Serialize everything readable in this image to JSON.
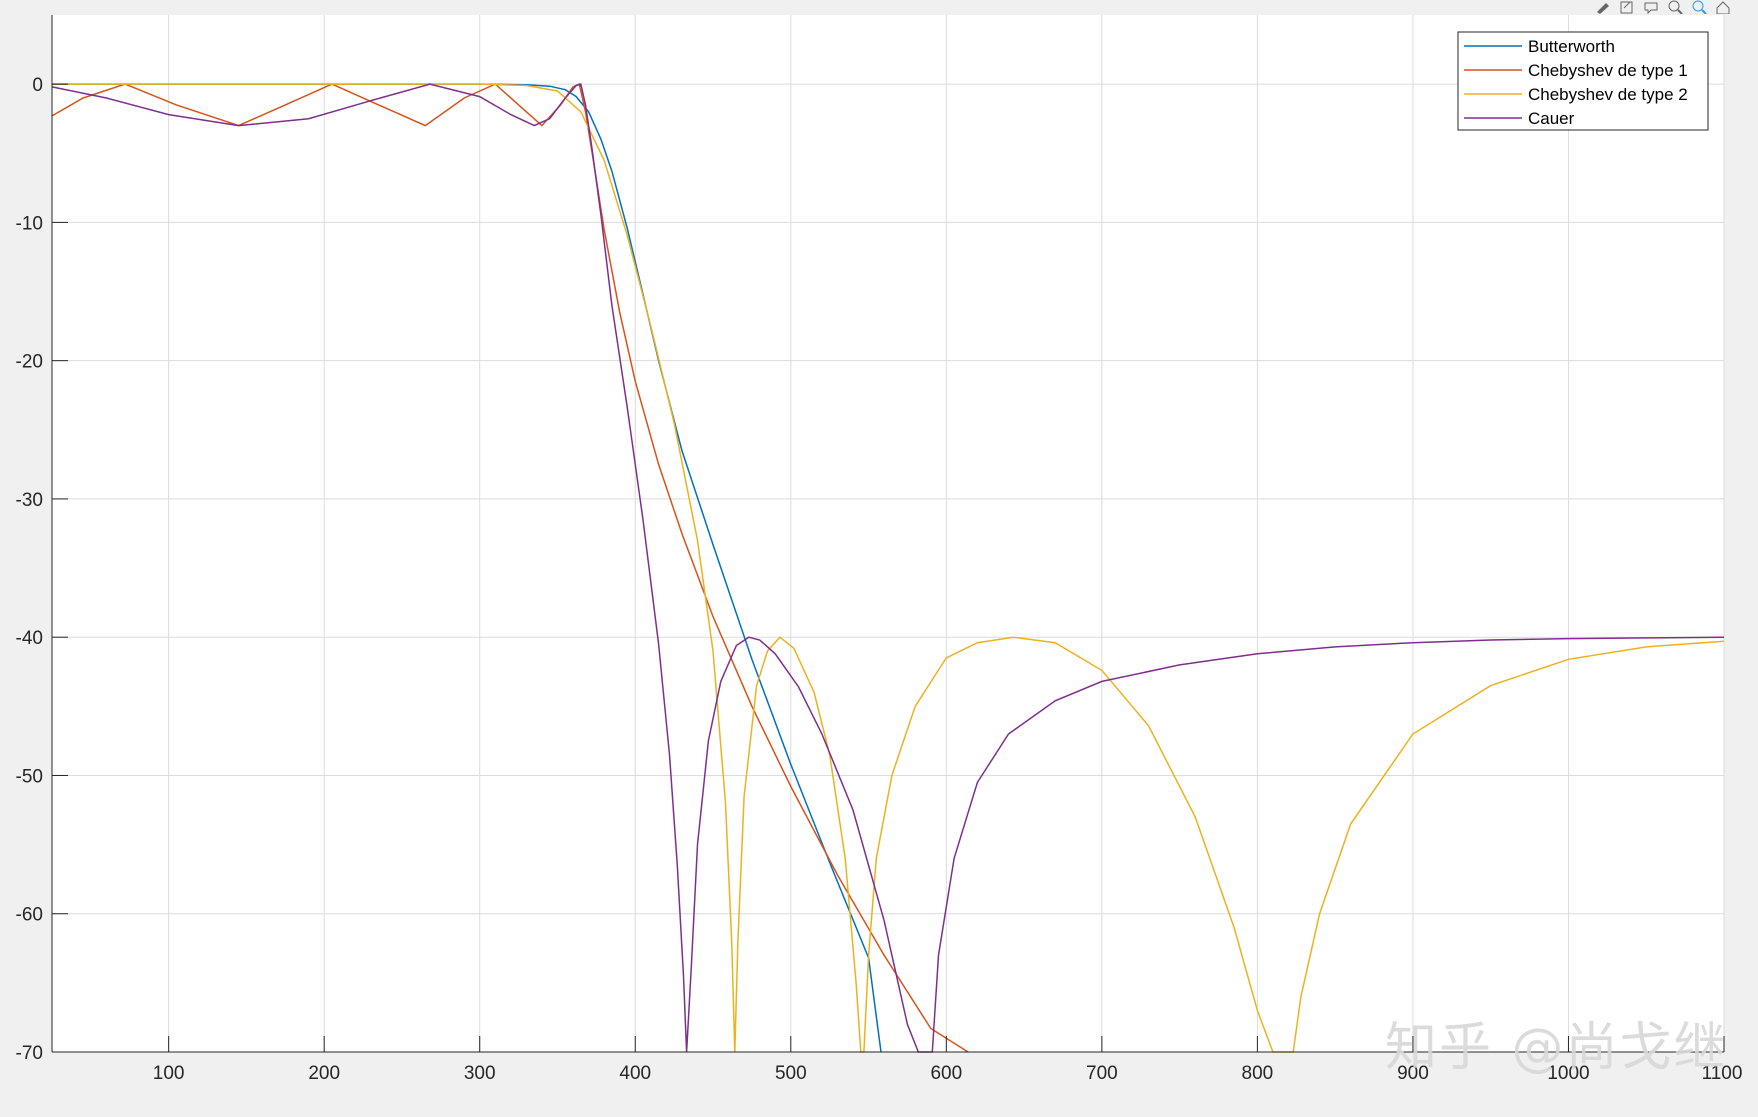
{
  "toolbar": {
    "icons": [
      "brush-icon",
      "export-icon",
      "datatips-icon",
      "zoom-in-icon",
      "zoom-out-icon",
      "home-icon"
    ]
  },
  "watermark": "知乎 @尚戈继",
  "chart_data": {
    "type": "line",
    "title": "",
    "xlabel": "",
    "ylabel": "",
    "xlim": [
      25,
      1100
    ],
    "ylim": [
      -70,
      5
    ],
    "grid": true,
    "legend_position": "top-right",
    "x_ticks": [
      100,
      200,
      300,
      400,
      500,
      600,
      700,
      800,
      900,
      1000,
      1100
    ],
    "y_ticks": [
      0,
      -10,
      -20,
      -30,
      -40,
      -50,
      -60,
      -70
    ],
    "series": [
      {
        "name": "Butterworth",
        "color": "#0072bd",
        "x": [
          25,
          100,
          200,
          300,
          330,
          345,
          355,
          362,
          370,
          378,
          385,
          395,
          405,
          415,
          430,
          450,
          475,
          500,
          525,
          550,
          558
        ],
        "y": [
          0,
          0,
          0,
          0,
          -0.05,
          -0.15,
          -0.4,
          -0.9,
          -2.0,
          -4.0,
          -6.3,
          -10.5,
          -15.2,
          -20.0,
          -26.5,
          -33.3,
          -41.6,
          -49.2,
          -56.3,
          -63.2,
          -70
        ]
      },
      {
        "name": "Chebyshev de type 1",
        "color": "#d95319",
        "x": [
          25,
          45,
          72,
          105,
          145,
          175,
          205,
          235,
          265,
          290,
          310,
          325,
          340,
          352,
          360,
          364,
          368,
          373,
          380,
          390,
          400,
          415,
          430,
          450,
          475,
          500,
          530,
          560,
          590,
          614
        ],
        "y": [
          -2.3,
          -1.0,
          0,
          -1.5,
          -3.0,
          -1.5,
          0,
          -1.5,
          -3.0,
          -1.0,
          0,
          -1.5,
          -3.0,
          -1.5,
          -0.2,
          0,
          -2.0,
          -5.5,
          -10.5,
          -16.5,
          -21.5,
          -27.5,
          -32.5,
          -38.5,
          -45.0,
          -50.8,
          -57.2,
          -63.0,
          -68.3,
          -70
        ]
      },
      {
        "name": "Chebyshev de type 2",
        "color": "#edb120",
        "x": [
          25,
          200,
          300,
          330,
          350,
          365,
          380,
          395,
          410,
          425,
          440,
          450,
          458,
          462,
          464,
          466,
          470,
          478,
          485,
          493,
          502,
          515,
          525,
          535,
          542,
          545,
          547,
          550,
          555,
          565,
          580,
          600,
          620,
          643,
          670,
          700,
          730,
          760,
          785,
          800,
          810,
          815,
          820,
          823,
          828,
          840,
          860,
          900,
          950,
          1000,
          1050,
          1100
        ],
        "y": [
          0,
          0,
          0,
          -0.1,
          -0.5,
          -2.0,
          -5.5,
          -11.0,
          -17.5,
          -24.5,
          -33.0,
          -41.0,
          -52.0,
          -62.0,
          -70,
          -62.0,
          -51.5,
          -43.5,
          -41.0,
          -40.0,
          -40.8,
          -44.0,
          -48.5,
          -56.0,
          -65.0,
          -70,
          -70,
          -63.0,
          -56.0,
          -50.0,
          -45.0,
          -41.5,
          -40.4,
          -40.0,
          -40.4,
          -42.4,
          -46.4,
          -53.0,
          -61.0,
          -67.0,
          -70,
          -70,
          -70,
          -70,
          -66.0,
          -60.0,
          -53.5,
          -47.0,
          -43.5,
          -41.6,
          -40.7,
          -40.3
        ]
      },
      {
        "name": "Cauer",
        "color": "#7e2f8e",
        "x": [
          25,
          60,
          100,
          145,
          190,
          230,
          268,
          300,
          320,
          335,
          345,
          355,
          362,
          365,
          368,
          372,
          378,
          385,
          395,
          405,
          415,
          422,
          427,
          431,
          433,
          436,
          440,
          447,
          455,
          465,
          473,
          480,
          490,
          505,
          520,
          540,
          560,
          575,
          582,
          585,
          588,
          591,
          595,
          605,
          620,
          640,
          670,
          700,
          750,
          800,
          850,
          900,
          950,
          1000,
          1050,
          1100
        ],
        "y": [
          -0.2,
          -1.0,
          -2.2,
          -3.0,
          -2.5,
          -1.2,
          0,
          -0.9,
          -2.2,
          -3.0,
          -2.5,
          -1.0,
          -0.1,
          0,
          -1.5,
          -4.5,
          -9.5,
          -16.0,
          -23.5,
          -31.5,
          -40.5,
          -48.5,
          -56.5,
          -64.5,
          -70,
          -64.0,
          -55.0,
          -47.5,
          -43.2,
          -40.6,
          -40.0,
          -40.2,
          -41.2,
          -43.6,
          -47.0,
          -52.5,
          -60.5,
          -68.0,
          -70,
          -70,
          -70,
          -70,
          -63.0,
          -56.0,
          -50.5,
          -47.0,
          -44.6,
          -43.2,
          -42.0,
          -41.2,
          -40.7,
          -40.4,
          -40.2,
          -40.1,
          -40.05,
          -40.0
        ]
      }
    ]
  }
}
